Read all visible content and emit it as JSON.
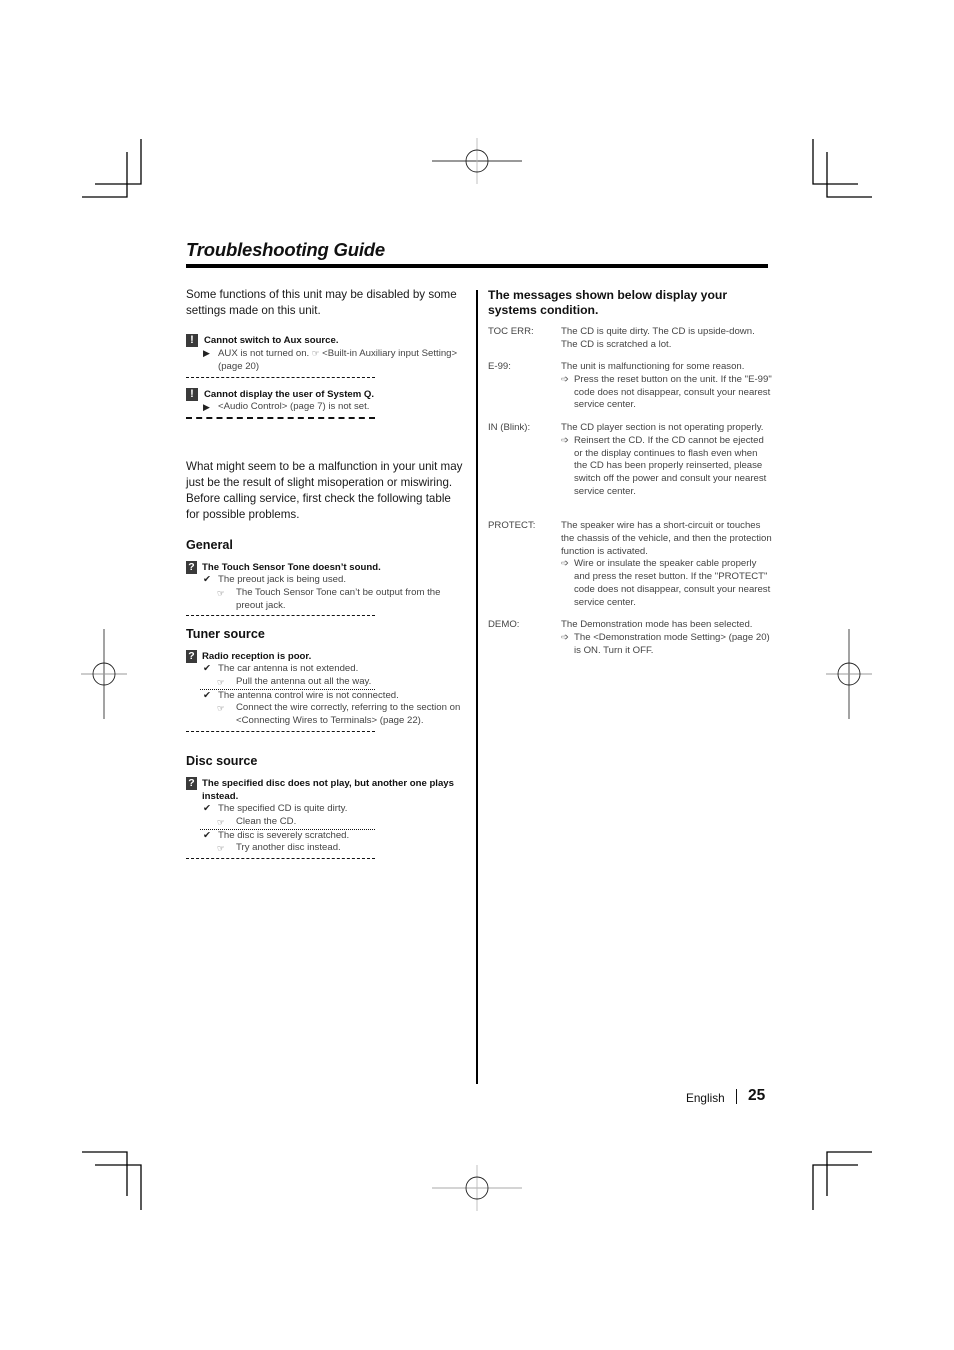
{
  "page": {
    "title": "Troubleshooting Guide",
    "footer": {
      "language": "English",
      "page_number": "25"
    }
  },
  "left_column": {
    "intro": "Some functions of this unit may be disabled by some settings made on this unit.",
    "restrictions": [
      {
        "icon": "exclamation-icon",
        "problem": "Cannot switch to Aux source.",
        "cause_prefix": "AUX is not turned on.",
        "cause_ref": "<Built-in Auxiliary input Setting> (page 20)"
      },
      {
        "icon": "exclamation-icon",
        "problem": "Cannot display the user of System Q.",
        "cause": "<Audio Control> (page 7) is not set."
      }
    ],
    "malfunction_intro": "What might seem to be a malfunction in your unit may just be the result of slight misoperation or miswiring. Before calling service, first check the following table for possible problems.",
    "sections": [
      {
        "heading": "General",
        "problems": [
          {
            "icon": "question-icon",
            "problem": "The Touch Sensor Tone doesn’t sound.",
            "causes": [
              {
                "cause": "The preout jack is being used.",
                "remedy": "The Touch Sensor Tone can’t be output from the preout jack."
              }
            ]
          }
        ]
      },
      {
        "heading": "Tuner source",
        "problems": [
          {
            "icon": "question-icon",
            "problem": "Radio reception is poor.",
            "causes": [
              {
                "cause": "The car antenna is not extended.",
                "remedy": "Pull the antenna out all the way."
              },
              {
                "cause": "The antenna control wire is not connected.",
                "remedy": "Connect the wire correctly, referring to the section on <Connecting Wires to Terminals> (page 22)."
              }
            ]
          }
        ]
      },
      {
        "heading": "Disc source",
        "problems": [
          {
            "icon": "question-icon",
            "problem": "The specified disc does not play, but another one plays instead.",
            "causes": [
              {
                "cause": "The specified CD is quite dirty.",
                "remedy": "Clean the CD."
              },
              {
                "cause": "The disc is severely scratched.",
                "remedy": "Try another disc instead."
              }
            ]
          }
        ]
      }
    ]
  },
  "right_column": {
    "heading": "The messages shown below display your systems condition.",
    "messages": [
      {
        "code": "TOC ERR:",
        "description": "The CD is quite dirty. The CD is upside-down. The CD is scratched a lot.",
        "remedy": ""
      },
      {
        "code": "E-99:",
        "description": "The unit is malfunctioning for some reason.",
        "remedy": "Press the reset button on the unit. If the \"E-99\" code does not disappear, consult your nearest service center."
      },
      {
        "code": "IN (Blink):",
        "description": "The CD player section is not operating properly.",
        "remedy": "Reinsert the CD. If the CD cannot be ejected or the display continues to flash even when the CD has been properly reinserted, please switch off the power and consult your nearest service center."
      },
      {
        "code": "PROTECT:",
        "description": "The speaker wire has a short-circuit or touches the chassis of the vehicle, and then the protection function is activated.",
        "remedy": "Wire or insulate the speaker cable properly and press the reset button. If the \"PROTECT\" code does not disappear, consult your nearest service center."
      },
      {
        "code": "DEMO:",
        "description": "The Demonstration mode has been selected.",
        "remedy": "The <Demonstration mode Setting> (page 20) is ON. Turn it OFF."
      }
    ]
  },
  "glyphs": {
    "exclamation": "!",
    "question": "?",
    "triangle": "▶",
    "check": "✔",
    "pointing_hand": "☞",
    "arrow": "➩"
  }
}
